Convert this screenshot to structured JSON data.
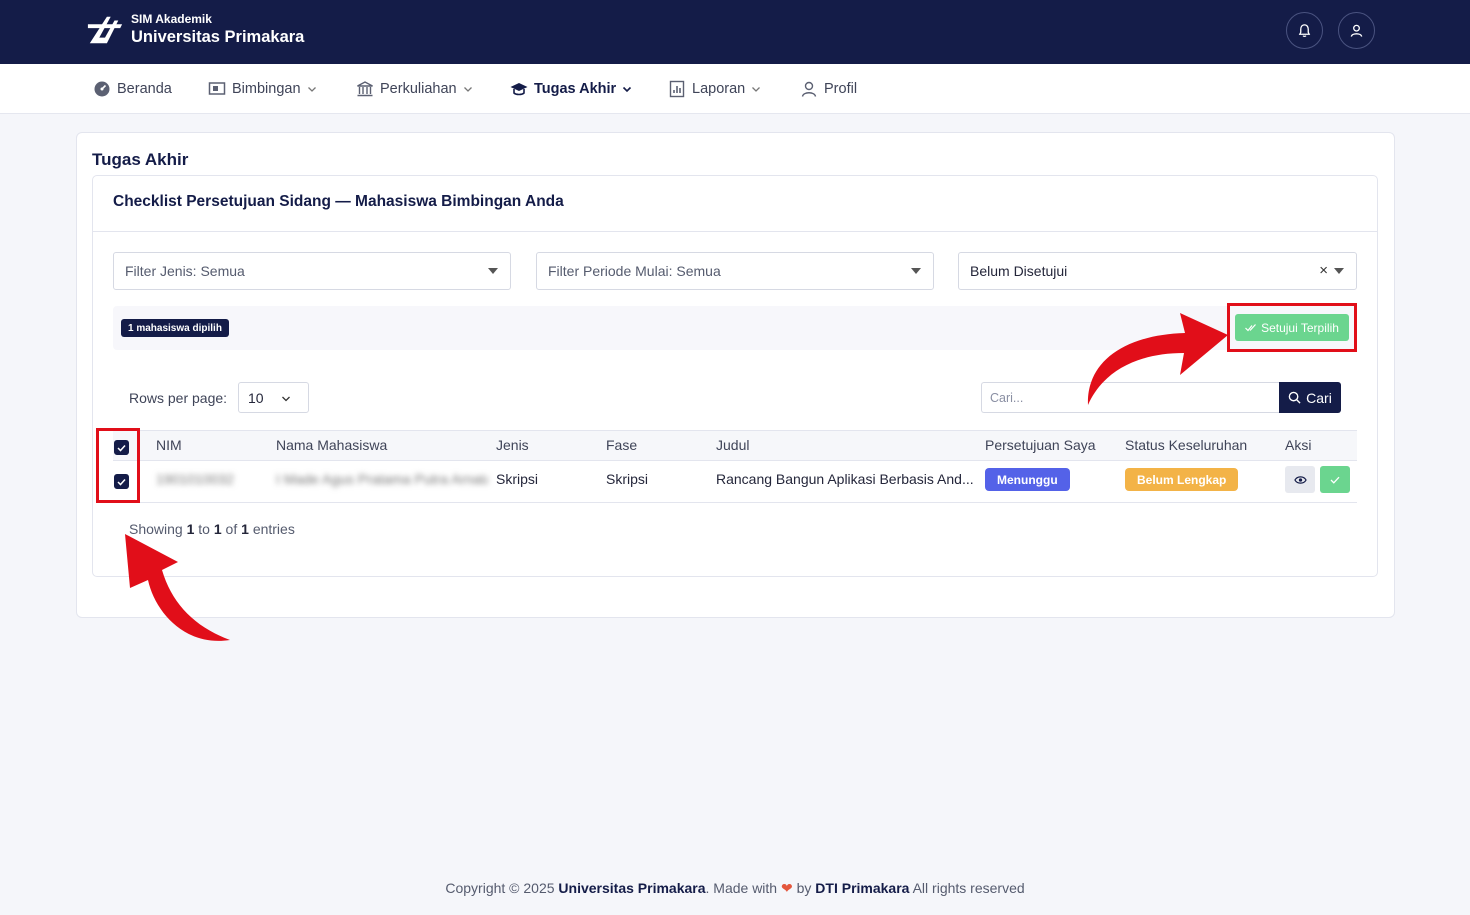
{
  "header": {
    "brand_small": "SIM Akademik",
    "brand_title": "Universitas Primakara",
    "icons": [
      "bell-icon",
      "user-icon"
    ]
  },
  "nav": {
    "items": [
      {
        "label": "Beranda",
        "icon": "gauge-icon",
        "dropdown": false
      },
      {
        "label": "Bimbingan",
        "icon": "board-icon",
        "dropdown": true
      },
      {
        "label": "Perkuliahan",
        "icon": "building-icon",
        "dropdown": true
      },
      {
        "label": "Tugas Akhir",
        "icon": "graduation-cap-icon",
        "dropdown": true,
        "active": true
      },
      {
        "label": "Laporan",
        "icon": "report-icon",
        "dropdown": true
      },
      {
        "label": "Profil",
        "icon": "user-icon",
        "dropdown": false
      }
    ]
  },
  "page": {
    "title": "Tugas Akhir",
    "card_title": "Checklist Persetujuan Sidang — Mahasiswa Bimbingan Anda"
  },
  "filters": {
    "jenis": "Filter Jenis: Semua",
    "periode": "Filter Periode Mulai: Semua",
    "status": "Belum Disetujui",
    "status_clear": "×"
  },
  "selection": {
    "count_label": "1 mahasiswa dipilih",
    "approve_label": "Setujui Terpilih"
  },
  "table_controls": {
    "rows_label": "Rows per page:",
    "rows_value": "10",
    "search_placeholder": "Cari...",
    "search_button": "Cari"
  },
  "table": {
    "columns": [
      "NIM",
      "Nama Mahasiswa",
      "Jenis",
      "Fase",
      "Judul",
      "Persetujuan Saya",
      "Status Keseluruhan",
      "Aksi"
    ],
    "rows": [
      {
        "nim": "1901010032",
        "nama": "I Made Agus Pratama Putra Arnata",
        "jenis": "Skripsi",
        "fase": "Skripsi",
        "judul": "Rancang Bangun Aplikasi Berbasis And...",
        "persetujuan": "Menunggu",
        "status": "Belum Lengkap",
        "checked": true
      }
    ]
  },
  "pagination": {
    "showing_prefix": "Showing",
    "from": "1",
    "to_word": "to",
    "to": "1",
    "of_word": "of",
    "total": "1",
    "suffix": "entries"
  },
  "footer": {
    "prefix": "Copyright © 2025",
    "org": "Universitas Primakara",
    "made_with": ". Made with",
    "by": "by",
    "team": "DTI Primakara",
    "rights": "All rights reserved"
  },
  "colors": {
    "primary": "#141c48",
    "success": "#6bd58f",
    "waiting": "#5462e8",
    "incomplete": "#f3b347",
    "highlight": "#e10e19"
  }
}
